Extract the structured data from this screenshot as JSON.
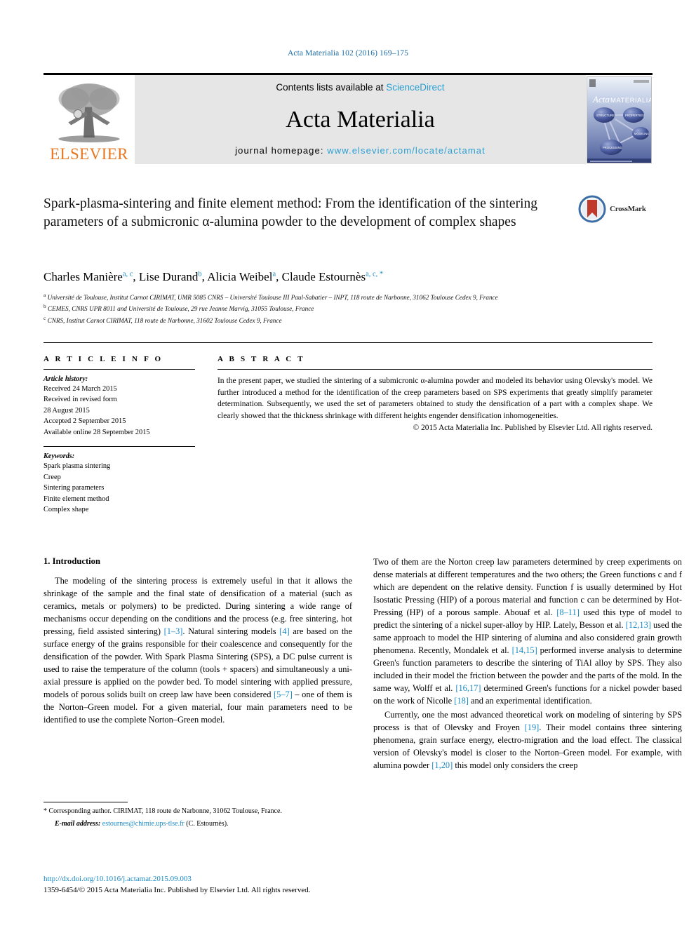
{
  "running_head": "Acta Materialia 102 (2016) 169–175",
  "masthead": {
    "publisher_name": "ELSEVIER",
    "contents_prefix": "Contents lists available at",
    "contents_link": "ScienceDirect",
    "journal_name": "Acta Materialia",
    "homepage_label": "journal homepage:",
    "homepage_url": "www.elsevier.com/locate/actamat",
    "cover_title_italic": "Acta",
    "cover_title_caps": "MATERIALIA",
    "cover_nodes": [
      "STRUCTURE",
      "PROPERTIES",
      "MODELING",
      "PROCESSING"
    ]
  },
  "crossmark": {
    "label": "CrossMark"
  },
  "title": "Spark-plasma-sintering and finite element method: From the identification of the sintering parameters of a submicronic α-alumina powder to the development of complex shapes",
  "authors": [
    {
      "name": "Charles Manière",
      "marks": "a, c",
      "sep": ", "
    },
    {
      "name": "Lise Durand",
      "marks": "b",
      "sep": ", "
    },
    {
      "name": "Alicia Weibel",
      "marks": "a",
      "sep": ", "
    },
    {
      "name": "Claude Estournès",
      "marks": "a, c, *",
      "sep": ""
    }
  ],
  "affiliations": [
    {
      "label": "a",
      "text": "Université de Toulouse, Institut Carnot CIRIMAT, UMR 5085 CNRS – Université Toulouse III Paul-Sabatier – INPT, 118 route de Narbonne, 31062 Toulouse Cedex 9, France"
    },
    {
      "label": "b",
      "text": "CEMES, CNRS UPR 8011 and Université de Toulouse, 29 rue Jeanne Marvig, 31055 Toulouse, France"
    },
    {
      "label": "c",
      "text": "CNRS, Institut Carnot CIRIMAT, 118 route de Narbonne, 31602 Toulouse Cedex 9, France"
    }
  ],
  "article_info": {
    "heading": "A R T I C L E  I N F O",
    "history_label": "Article history:",
    "history": [
      "Received 24 March 2015",
      "Received in revised form",
      "28 August 2015",
      "Accepted 2 September 2015",
      "Available online 28 September 2015"
    ],
    "keywords_label": "Keywords:",
    "keywords": [
      "Spark plasma sintering",
      "Creep",
      "Sintering parameters",
      "Finite element method",
      "Complex shape"
    ]
  },
  "abstract": {
    "heading": "A B S T R A C T",
    "text": "In the present paper, we studied the sintering of a submicronic α-alumina powder and modeled its behavior using Olevsky's model. We further introduced a method for the identification of the creep parameters based on SPS experiments that greatly simplify parameter determination. Subsequently, we used the set of parameters obtained to study the densification of a part with a complex shape. We clearly showed that the thickness shrinkage with different heights engender densification inhomogeneities.",
    "copyright": "© 2015 Acta Materialia Inc. Published by Elsevier Ltd. All rights reserved."
  },
  "section": {
    "number_title": "1. Introduction"
  },
  "body": {
    "left_p1_a": "The modeling of the sintering process is extremely useful in that it allows the shrinkage of the sample and the final state of densification of a material (such as ceramics, metals or polymers) to be predicted. During sintering a wide range of mechanisms occur depending on the conditions and the process (e.g. free sintering, hot pressing, field assisted sintering) ",
    "left_ref1": "[1–3]",
    "left_p1_b": ". Natural sintering models ",
    "left_ref2": "[4]",
    "left_p1_c": " are based on the surface energy of the grains responsible for their coalescence and consequently for the densification of the powder. With Spark Plasma Sintering (SPS), a DC pulse current is used to raise the temperature of the column (tools + spacers) and simultaneously a uni-axial pressure is applied on the powder bed. To model sintering with applied pressure, models of porous solids built on creep law have been considered ",
    "left_ref3": "[5–7]",
    "left_p1_d": " – one of them is the Norton–Green model. For a given material, four main parameters need to be identified to use the complete Norton–Green model.",
    "right_p1_a": "Two of them are the Norton creep law parameters determined by creep experiments on dense materials at different temperatures and the two others; the Green functions c and f which are dependent on the relative density. Function f is usually determined by Hot Isostatic Pressing (HIP) of a porous material and function c can be determined by Hot-Pressing (HP) of a porous sample. Abouaf et al. ",
    "right_ref1": "[8–11]",
    "right_p1_b": " used this type of model to predict the sintering of a nickel super-alloy by HIP. Lately, Besson et al. ",
    "right_ref2": "[12,13]",
    "right_p1_c": " used the same approach to model the HIP sintering of alumina and also considered grain growth phenomena. Recently, Mondalek et al. ",
    "right_ref3": "[14,15]",
    "right_p1_d": " performed inverse analysis to determine Green's function parameters to describe the sintering of TiAl alloy by SPS. They also included in their model the friction between the powder and the parts of the mold. In the same way, Wolff et al. ",
    "right_ref4": "[16,17]",
    "right_p1_e": " determined Green's functions for a nickel powder based on the work of Nicolle ",
    "right_ref5": "[18]",
    "right_p1_f": " and an experimental identification.",
    "right_p2_a": "Currently, one the most advanced theoretical work on modeling of sintering by SPS process is that of Olevsky and Froyen ",
    "right_ref6": "[19]",
    "right_p2_b": ". Their model contains three sintering phenomena, grain surface energy, electro-migration and the load effect. The classical version of Olevsky's model is closer to the Norton–Green model. For example, with alumina powder ",
    "right_ref7": "[1,20]",
    "right_p2_c": " this model only considers the creep"
  },
  "footnote": {
    "star": "*",
    "corresponding": " Corresponding author. CIRIMAT, 118 route de Narbonne, 31062 Toulouse, France.",
    "email_label": "E-mail address:",
    "email_address": "estournes@chimie.ups-tlse.fr",
    "email_owner": "(C. Estournès)."
  },
  "doi": {
    "url": "http://dx.doi.org/10.1016/j.actamat.2015.09.003",
    "issn_line": "1359-6454/© 2015 Acta Materialia Inc. Published by Elsevier Ltd. All rights reserved."
  },
  "colors": {
    "link_blue": "#1a8ac4",
    "header_blue": "#1a6ca8",
    "sciencedirect_blue": "#2a9fd0",
    "elsevier_orange": "#E87722",
    "banner_grey": "#e6e6e6",
    "crossmark_red": "#c0392b"
  }
}
